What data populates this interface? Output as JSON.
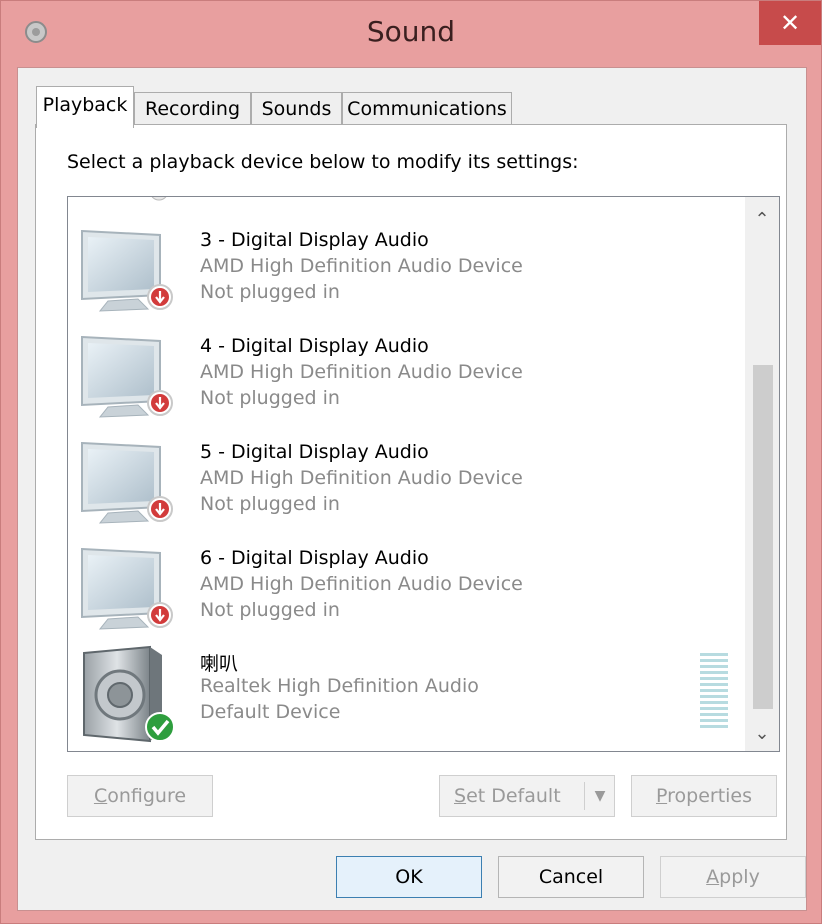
{
  "window": {
    "title": "Sound",
    "close_glyph": "✕"
  },
  "tabs": [
    {
      "label": "Playback"
    },
    {
      "label": "Recording"
    },
    {
      "label": "Sounds"
    },
    {
      "label": "Communications"
    }
  ],
  "instruction": "Select a playback device below to modify its settings:",
  "devices": [
    {
      "name": "3 - Digital Display Audio",
      "description": "AMD High Definition Audio Device",
      "status": "Not plugged in",
      "icon": "monitor-icon",
      "badge": "unplugged-badge-icon"
    },
    {
      "name": "4 - Digital Display Audio",
      "description": "AMD High Definition Audio Device",
      "status": "Not plugged in",
      "icon": "monitor-icon",
      "badge": "unplugged-badge-icon"
    },
    {
      "name": "5 - Digital Display Audio",
      "description": "AMD High Definition Audio Device",
      "status": "Not plugged in",
      "icon": "monitor-icon",
      "badge": "unplugged-badge-icon"
    },
    {
      "name": "6 - Digital Display Audio",
      "description": "AMD High Definition Audio Device",
      "status": "Not plugged in",
      "icon": "monitor-icon",
      "badge": "unplugged-badge-icon"
    },
    {
      "name": "喇叭",
      "description": "Realtek High Definition Audio",
      "status": "Default Device",
      "icon": "speaker-icon",
      "badge": "default-check-icon"
    }
  ],
  "scrollbar": {
    "up_glyph": "⌃",
    "down_glyph": "⌄"
  },
  "buttons": {
    "configure": {
      "accel": "C",
      "rest": "onfigure"
    },
    "set_default": {
      "accel": "S",
      "rest": "et Default"
    },
    "properties": {
      "accel": "P",
      "rest": "roperties"
    },
    "ok": "OK",
    "cancel": "Cancel",
    "apply": {
      "accel": "A",
      "rest": "pply"
    }
  },
  "colors": {
    "titlebar": "#e89f9f",
    "close": "#c74b4b",
    "unplugged_badge": "#d23b3b",
    "default_badge": "#2e9e3e",
    "level_meter": "#b7dbe0"
  }
}
